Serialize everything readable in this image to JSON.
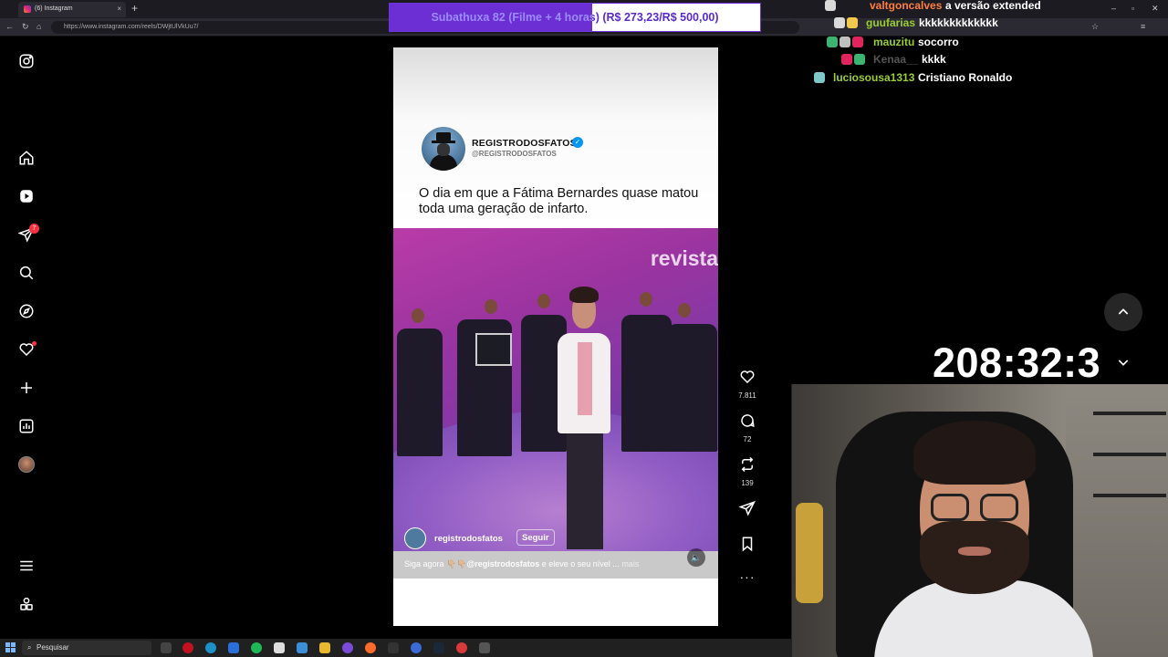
{
  "browser": {
    "tab_title": "(6) Instagram",
    "tab_close": "×",
    "new_tab": "+",
    "url": "https://www.instagram.com/reels/DWjtUlVkUu7/"
  },
  "sidebar": {
    "notification_count": "7"
  },
  "post": {
    "username": "REGISTRODOSFATOS",
    "handle": "@REGISTRODOSFATOS",
    "headline": "O dia em que a Fátima Bernardes quase matou toda uma geração de infarto.",
    "video_watermark": "revista",
    "video_username": "registrodosfatos",
    "follow_label": "Seguir",
    "caption_prefix": "Siga agora 👇🏼👇🏼",
    "caption_mention": "@registrodosfatos",
    "caption_rest": " e eleve o seu nível ...",
    "caption_more": " mais"
  },
  "actions": {
    "likes": "7.811",
    "comments": "72",
    "reposts": "139"
  },
  "overlay": {
    "goal_text": "Subathuxa 82 (Filme + 4 horas) (R$ 273,23/R$ 500,00)",
    "goal_progress": 0.546,
    "timer": "208:32:3"
  },
  "chat": [
    {
      "user": "valtgoncalves",
      "message": "a versão extended",
      "color": "#ff7f3f",
      "badges": [
        "#d9d9d9"
      ]
    },
    {
      "user": "guufarias",
      "message": "kkkkkkkkkkkkk",
      "color": "#9acd32",
      "badges": [
        "#d9d9d9",
        "#f2c94c"
      ]
    },
    {
      "user": "mauzitu",
      "message": "socorro",
      "color": "#9acd32",
      "badges": [
        "#3cb371",
        "#c0c0c0",
        "#e0245e"
      ]
    },
    {
      "user": "Kenaa__",
      "message": "kkkk",
      "color": "#555555",
      "badges": [
        "#e0245e",
        "#3cb371"
      ]
    },
    {
      "user": "luciosousa1313",
      "message": "Cristiano Ronaldo",
      "color": "#9acd32",
      "badges": [
        "#7fc8c8"
      ]
    }
  ],
  "taskbar": {
    "search_placeholder": "Pesquisar"
  },
  "colors": {
    "instagram_blue": "#0095f6",
    "notification_red": "#ff3040",
    "goal_purple": "#6b2fd4"
  }
}
